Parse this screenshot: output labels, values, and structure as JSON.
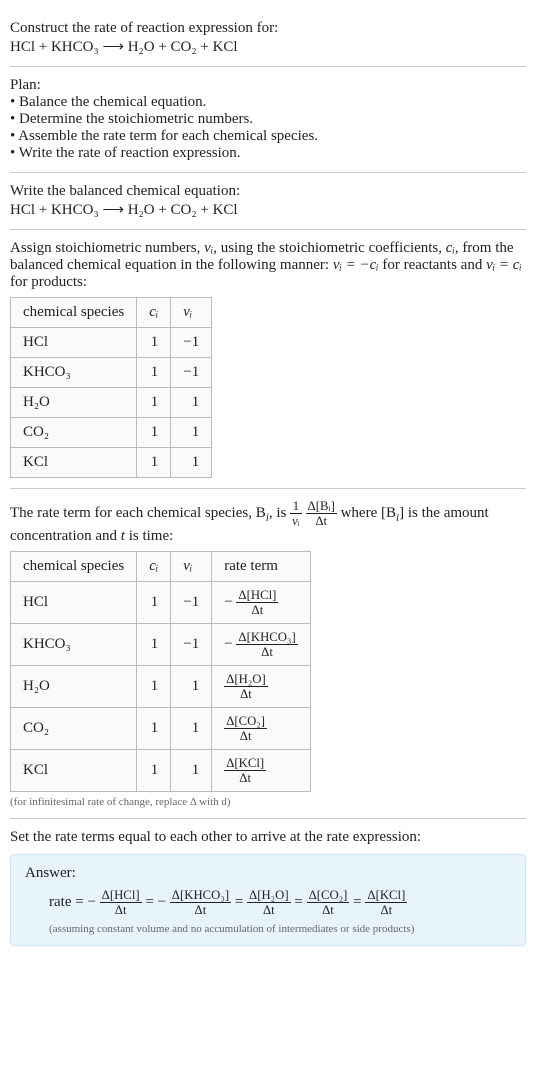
{
  "prompt": {
    "line1": "Construct the rate of reaction expression for:",
    "reaction": "HCl + KHCO₃  ⟶  H₂O + CO₂ + KCl"
  },
  "plan": {
    "heading": "Plan:",
    "items": [
      "• Balance the chemical equation.",
      "• Determine the stoichiometric numbers.",
      "• Assemble the rate term for each chemical species.",
      "• Write the rate of reaction expression."
    ]
  },
  "balanced": {
    "heading": "Write the balanced chemical equation:",
    "reaction": "HCl + KHCO₃  ⟶  H₂O + CO₂ + KCl"
  },
  "stoich_assign": {
    "text_parts": {
      "a": "Assign stoichiometric numbers, ",
      "b": ", using the stoichiometric coefficients, ",
      "c": ", from the balanced chemical equation in the following manner: ",
      "d": " for reactants and ",
      "e": " for products:"
    },
    "headers": [
      "chemical species",
      "cᵢ",
      "νᵢ"
    ],
    "rows": [
      {
        "species": "HCl",
        "c": "1",
        "nu": "−1"
      },
      {
        "species": "KHCO₃",
        "c": "1",
        "nu": "−1"
      },
      {
        "species": "H₂O",
        "c": "1",
        "nu": "1"
      },
      {
        "species": "CO₂",
        "c": "1",
        "nu": "1"
      },
      {
        "species": "KCl",
        "c": "1",
        "nu": "1"
      }
    ]
  },
  "rate_term": {
    "text_parts": {
      "a": "The rate term for each chemical species, B",
      "b": ", is ",
      "c": " where [B",
      "d": "] is the amount concentration and ",
      "e": " is time:"
    },
    "headers": [
      "chemical species",
      "cᵢ",
      "νᵢ",
      "rate term"
    ],
    "rows": [
      {
        "species": "HCl",
        "c": "1",
        "nu": "−1",
        "rt_top": "Δ[HCl]",
        "rt_bot": "Δt",
        "neg": "− "
      },
      {
        "species": "KHCO₃",
        "c": "1",
        "nu": "−1",
        "rt_top": "Δ[KHCO₃]",
        "rt_bot": "Δt",
        "neg": "− "
      },
      {
        "species": "H₂O",
        "c": "1",
        "nu": "1",
        "rt_top": "Δ[H₂O]",
        "rt_bot": "Δt",
        "neg": ""
      },
      {
        "species": "CO₂",
        "c": "1",
        "nu": "1",
        "rt_top": "Δ[CO₂]",
        "rt_bot": "Δt",
        "neg": ""
      },
      {
        "species": "KCl",
        "c": "1",
        "nu": "1",
        "rt_top": "Δ[KCl]",
        "rt_bot": "Δt",
        "neg": ""
      }
    ],
    "note": "(for infinitesimal rate of change, replace Δ with d)"
  },
  "final": {
    "heading": "Set the rate terms equal to each other to arrive at the rate expression:",
    "answer_label": "Answer:",
    "rate_prefix": "rate = ",
    "terms": [
      {
        "neg": "− ",
        "top": "Δ[HCl]",
        "bot": "Δt"
      },
      {
        "neg": "− ",
        "top": "Δ[KHCO₃]",
        "bot": "Δt"
      },
      {
        "neg": "",
        "top": "Δ[H₂O]",
        "bot": "Δt"
      },
      {
        "neg": "",
        "top": "Δ[CO₂]",
        "bot": "Δt"
      },
      {
        "neg": "",
        "top": "Δ[KCl]",
        "bot": "Δt"
      }
    ],
    "eq_sep": " = ",
    "disclaimer": "(assuming constant volume and no accumulation of intermediates or side products)"
  },
  "sym": {
    "nu_i": "νᵢ",
    "c_i": "cᵢ",
    "nu_eq_neg_c": "νᵢ = −cᵢ",
    "nu_eq_c": "νᵢ = cᵢ",
    "i_sub": "i",
    "t_it": "t",
    "one": "1",
    "dBi": "Δ[Bᵢ]",
    "dt": "Δt"
  },
  "chart_data": null
}
